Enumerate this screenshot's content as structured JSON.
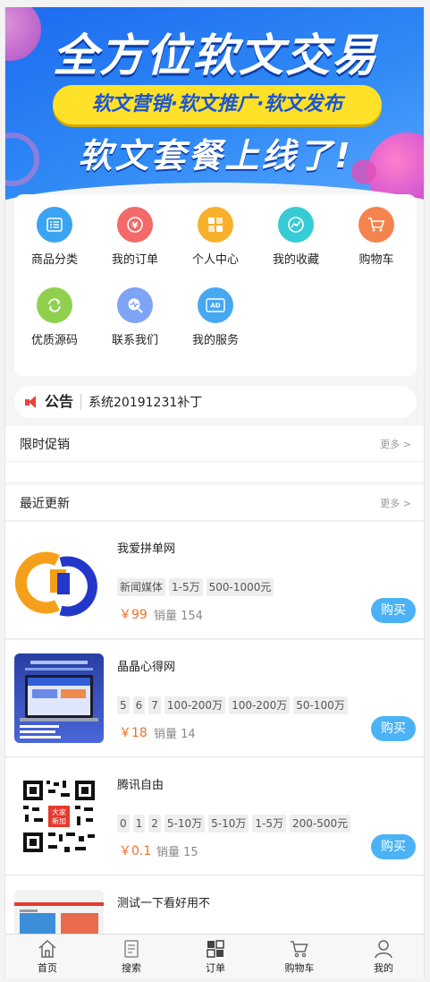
{
  "banner": {
    "title": "全方位软文交易",
    "tagline": "软文营销·软文推广·软文发布",
    "subtitle": "软文套餐上线了!"
  },
  "menu": [
    {
      "label": "商品分类",
      "icon": "list-icon",
      "color": "#3aa4f2"
    },
    {
      "label": "我的订单",
      "icon": "yen-icon",
      "color": "#f26a6a"
    },
    {
      "label": "个人中心",
      "icon": "grid-icon",
      "color": "#f8b12d"
    },
    {
      "label": "我的收藏",
      "icon": "trend-icon",
      "color": "#37cbd6"
    },
    {
      "label": "购物车",
      "icon": "cart-icon",
      "color": "#f5834e"
    },
    {
      "label": "优质源码",
      "icon": "refresh-icon",
      "color": "#8fd14f"
    },
    {
      "label": "联系我们",
      "icon": "search-pulse-icon",
      "color": "#7fa4f5"
    },
    {
      "label": "我的服务",
      "icon": "ad-icon",
      "color": "#47a8f2"
    }
  ],
  "notice": {
    "title": "公告",
    "text": "系统20191231补丁"
  },
  "promo": {
    "title": "限时促销",
    "more": "更多 >"
  },
  "recent": {
    "title": "最近更新",
    "more": "更多 >"
  },
  "products": [
    {
      "name": "我爱拼单网",
      "tags": [
        "新闻媒体",
        "1-5万",
        "500-1000元"
      ],
      "price": "￥99",
      "sales": "销量 154",
      "buy": "购买"
    },
    {
      "name": "晶晶心得网",
      "tags": [
        "5",
        "6",
        "7",
        "100-200万",
        "100-200万",
        "50-100万"
      ],
      "price": "￥18",
      "sales": "销量 14",
      "buy": "购买"
    },
    {
      "name": "腾讯自由",
      "tags": [
        "0",
        "1",
        "2",
        "5-10万",
        "5-10万",
        "1-5万",
        "200-500元"
      ],
      "price": "￥0.1",
      "sales": "销量 15",
      "buy": "购买"
    },
    {
      "name": "测试一下看好用不",
      "tags": [],
      "price": "",
      "sales": "",
      "buy": ""
    }
  ],
  "tabbar": [
    {
      "label": "首页",
      "icon": "home-icon"
    },
    {
      "label": "搜索",
      "icon": "doc-icon"
    },
    {
      "label": "订单",
      "icon": "grid-icon"
    },
    {
      "label": "购物车",
      "icon": "cart-icon"
    },
    {
      "label": "我的",
      "icon": "user-icon"
    }
  ]
}
